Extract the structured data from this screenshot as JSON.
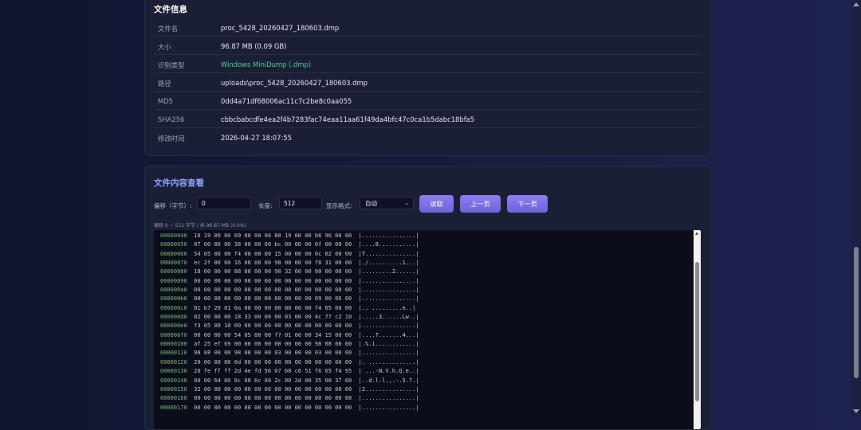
{
  "file_info": {
    "title": "文件信息",
    "rows": [
      {
        "key": "文件名",
        "value": "proc_5428_20260427_180603.dmp"
      },
      {
        "key": "大小",
        "value": "96.87 MB (0.09 GB)"
      },
      {
        "key": "识别类型",
        "value": "Windows MiniDump (.dmp)"
      },
      {
        "key": "路径",
        "value": "uploads\\proc_5428_20260427_180603.dmp"
      },
      {
        "key": "MD5",
        "value": "0dd4a71df68006ac11c7c2be8c0aa055"
      },
      {
        "key": "SHA256",
        "value": "cbbcbabcdfe4ea2f4b7283fac74eaa11aa61f49da4bfc47c0ca1b5dabc18bfa5"
      },
      {
        "key": "修改时间",
        "value": "2026-04-27 18:07:55"
      }
    ]
  },
  "viewer": {
    "title": "文件内容查看",
    "offset_label": "偏移（字节）:",
    "offset_value": "0",
    "length_label": "长度:",
    "length_value": "512",
    "format_label": "显示格式:",
    "format_value": "自动",
    "read_button": "读取",
    "prev_button": "上一页",
    "next_button": "下一页",
    "caption": "偏移 0 ~ 512 字节 / 共 96.87 MB (0.0%)",
    "lines": [
      {
        "offset": "00000040",
        "bytes": "10 19 00 00 09 00 00 00 80 19 00 00 b6 96 00 00",
        "ascii": "|................|"
      },
      {
        "offset": "00000050",
        "bytes": "07 00 00 00 38 00 00 00 bc 00 00 00 0f 00 00 00",
        "ascii": "|....8...........|"
      },
      {
        "offset": "00000060",
        "bytes": "54 05 00 00 f4 00 00 00 15 00 00 00 0c 02 00 00",
        "ascii": "|T...............|"
      },
      {
        "offset": "00000070",
        "bytes": "ec 2f 00 00 16 00 00 00 98 00 00 00 f8 31 00 00",
        "ascii": "|./..........1...|"
      },
      {
        "offset": "00000080",
        "bytes": "18 00 00 00 88 00 00 00 90 32 00 00 00 00 00 00",
        "ascii": "|.........2......|"
      },
      {
        "offset": "00000090",
        "bytes": "00 00 00 00 00 00 00 00 00 00 00 00 00 00 00 00",
        "ascii": "|................|"
      },
      {
        "offset": "000000a0",
        "bytes": "00 00 00 00 00 00 00 00 00 00 00 00 00 00 00 00",
        "ascii": "|................|"
      },
      {
        "offset": "000000b0",
        "bytes": "00 00 00 00 00 00 00 00 00 00 00 00 09 00 06 00",
        "ascii": "|................|"
      },
      {
        "offset": "000000c0",
        "bytes": "01 b7 20 01 0a 00 00 00 00 00 00 00 f4 65 00 00",
        "ascii": "|.. .........e..|"
      },
      {
        "offset": "000000d0",
        "bytes": "02 00 00 00 18 33 00 00 00 03 00 00 4c 77 c2 10",
        "ascii": "|.....3......Lw..|"
      },
      {
        "offset": "000000e0",
        "bytes": "f3 05 00 10 00 00 00 00 00 00 00 00 00 00 00 00",
        "ascii": "|................|"
      },
      {
        "offset": "000000f0",
        "bytes": "00 00 00 00 54 05 00 00 f7 01 00 00 34 15 00 00",
        "ascii": "|....T.......4...|"
      },
      {
        "offset": "00000100",
        "bytes": "af 25 ef 69 00 00 00 00 00 00 00 00 98 08 00 00",
        "ascii": "|.%.i............|"
      },
      {
        "offset": "00000110",
        "bytes": "98 08 00 00 98 08 00 00 03 00 00 00 03 00 00 00",
        "ascii": "|................|"
      },
      {
        "offset": "00000120",
        "bytes": "20 00 00 00 0d 00 00 00 00 00 00 00 00 00 00 00",
        "ascii": "|. ..............|"
      },
      {
        "offset": "00000130",
        "bytes": "20 fe ff ff 2d 4e fd 56 07 68 c6 51 f6 65 f4 95",
        "ascii": "| ...-N.V.h.Q.e..|"
      },
      {
        "offset": "00000140",
        "bytes": "00 00 64 00 6c 00 6c 00 2c 00 2d 00 35 00 37 00",
        "ascii": "|..d.l.l.,.-.5.7.|"
      },
      {
        "offset": "00000150",
        "bytes": "32 00 00 00 00 00 00 00 00 00 00 00 00 00 00 00",
        "ascii": "|2...............|"
      },
      {
        "offset": "00000160",
        "bytes": "00 00 00 00 00 00 00 00 00 00 00 00 00 00 00 00",
        "ascii": "|................|"
      },
      {
        "offset": "00000170",
        "bytes": "00 00 00 00 00 00 00 00 00 00 00 00 00 00 00 00",
        "ascii": "|................|"
      }
    ]
  }
}
